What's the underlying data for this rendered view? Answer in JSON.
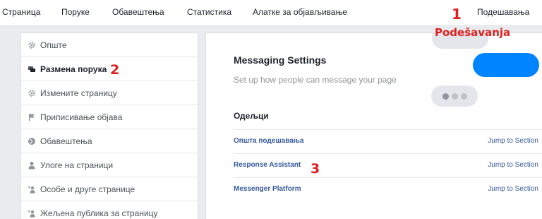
{
  "nav": {
    "tabs": [
      "Страница",
      "Поруке",
      "Обавештења",
      "Статистика",
      "Алатке за објављивање",
      "Подешавања"
    ]
  },
  "sidebar": {
    "items": [
      {
        "label": "Опште",
        "icon": "gear-icon"
      },
      {
        "label": "Размена порука",
        "icon": "message-bubble-icon"
      },
      {
        "label": "Измените страницу",
        "icon": "gear-icon"
      },
      {
        "label": "Приписивање објава",
        "icon": "flag-icon"
      },
      {
        "label": "Обавештења",
        "icon": "globe-icon"
      },
      {
        "label": "Улоге на страници",
        "icon": "person-icon"
      },
      {
        "label": "Особе и друге странице",
        "icon": "person-plus-icon"
      },
      {
        "label": "Жељена публика за страницу",
        "icon": "person-plus-icon"
      }
    ]
  },
  "main": {
    "title": "Messaging Settings",
    "subtitle": "Set up how people can message your page",
    "sections_heading": "Одељци",
    "sections": [
      {
        "label": "Општа подешавања",
        "link": "Jump to Section"
      },
      {
        "label": "Response Assistant",
        "link": "Jump to Section"
      },
      {
        "label": "Messenger Platform",
        "link": "Jump to Section"
      }
    ]
  },
  "annotations": {
    "n1": "1",
    "caption1": "Podešavanja",
    "n2": "2",
    "n3": "3",
    "color": "#e0201e"
  },
  "colors": {
    "link": "#365899",
    "messenger_blue": "#0084ff",
    "background": "#e9ebee"
  }
}
